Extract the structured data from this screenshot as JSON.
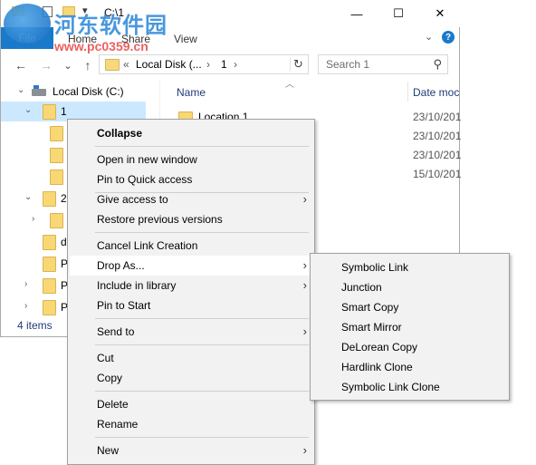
{
  "window": {
    "title": "C:\\1",
    "minimize_glyph": "—",
    "maximize_glyph": "☐",
    "close_glyph": "✕"
  },
  "ribbon": {
    "file": "File",
    "tabs": [
      "Home",
      "Share",
      "View"
    ],
    "help_glyph": "?",
    "expand_glyph": "⌄"
  },
  "nav": {
    "back_glyph": "←",
    "forward_glyph": "→",
    "recent_glyph": "⌄",
    "up_glyph": "↑",
    "address_prefix": "«",
    "address_drive": "Local Disk (...",
    "address_sep": "›",
    "address_folder": "1",
    "refresh_glyph": "↻",
    "search_placeholder": "Search 1",
    "search_icon": "search-icon"
  },
  "tree": {
    "drive_label": "Local Disk (C:)",
    "items": [
      {
        "label": "1"
      },
      {
        "label": ""
      },
      {
        "label": ""
      },
      {
        "label": ""
      },
      {
        "label": "2"
      },
      {
        "label": ""
      },
      {
        "label": "d"
      },
      {
        "label": "P"
      },
      {
        "label": "P"
      },
      {
        "label": "P"
      }
    ],
    "expanded_glyph": "⌄",
    "collapsed_glyph": "›"
  },
  "status": "4 items",
  "columns": {
    "name": "Name",
    "date": "Date moc",
    "sort_glyph": "︿"
  },
  "files": [
    {
      "name": "Location 1",
      "date": "23/10/201"
    },
    {
      "name": "",
      "date": "23/10/201"
    },
    {
      "name": "",
      "date": "23/10/201"
    },
    {
      "name": "",
      "date": "15/10/201"
    }
  ],
  "watermark": {
    "line1": "河东软件园",
    "line2": "www.pc0359.cn"
  },
  "context_menu": {
    "collapse": "Collapse",
    "open_new_window": "Open in new window",
    "pin_quick_access": "Pin to Quick access",
    "give_access": "Give access to",
    "restore_versions": "Restore previous versions",
    "cancel_link": "Cancel Link Creation",
    "drop_as": "Drop As...",
    "include_library": "Include in library",
    "pin_start": "Pin to Start",
    "send_to": "Send to",
    "cut": "Cut",
    "copy": "Copy",
    "delete": "Delete",
    "rename": "Rename",
    "new": "New",
    "submenu_glyph": "›"
  },
  "drop_as_menu": {
    "items": [
      "Symbolic Link",
      "Junction",
      "Smart Copy",
      "Smart Mirror",
      "DeLorean Copy",
      "Hardlink Clone",
      "Symbolic Link Clone"
    ]
  }
}
